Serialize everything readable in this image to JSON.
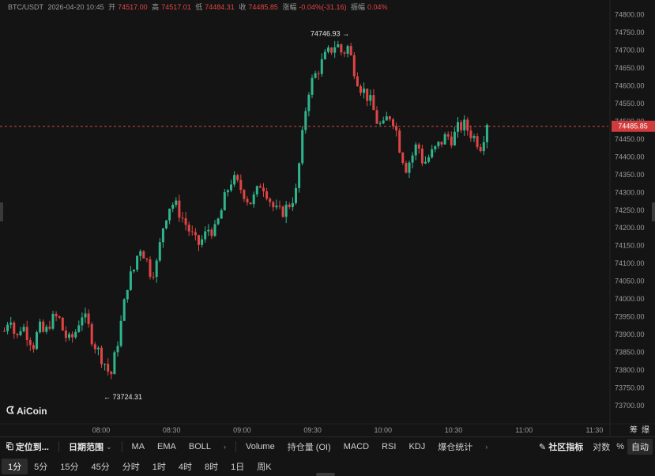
{
  "header": {
    "pair": "BTC/USDT",
    "datetime": "2026-04-20 10:45",
    "open_label": "开",
    "open_value": "74517.00",
    "high_label": "高",
    "high_value": "74517.01",
    "low_label": "低",
    "low_value": "74484.31",
    "close_label": "收",
    "close_value": "74485.85",
    "change_label": "涨幅",
    "change_value": "-0.04%(-31.16)",
    "amplitude_label": "振幅",
    "amplitude_value": "0.04%"
  },
  "logo": {
    "text": "AiCoin",
    "icon": "aicoin-logo-icon"
  },
  "colors": {
    "up": "#2fb58d",
    "down": "#e04545",
    "price_line": "#c94a4a",
    "background": "#141414",
    "axis_text": "#9a9a9a"
  },
  "chart_data": {
    "type": "candlestick",
    "ylim": [
      73680,
      74810
    ],
    "y_ticks": [
      "74800.00",
      "74750.00",
      "74700.00",
      "74650.00",
      "74600.00",
      "74550.00",
      "74500.00",
      "74450.00",
      "74400.00",
      "74350.00",
      "74300.00",
      "74250.00",
      "74200.00",
      "74150.00",
      "74100.00",
      "74050.00",
      "74000.00",
      "73950.00",
      "73900.00",
      "73850.00",
      "73800.00",
      "73750.00",
      "73700.00"
    ],
    "x_ticks": [
      "08:00",
      "08:30",
      "09:00",
      "09:30",
      "10:00",
      "10:30",
      "11:00",
      "11:30"
    ],
    "current_price": "74485.85",
    "high_annotation": "74746.93",
    "low_annotation": "73724.31",
    "close_path": [
      [
        73910,
        0
      ],
      [
        73960,
        3
      ],
      [
        73880,
        6
      ],
      [
        73930,
        9
      ],
      [
        73900,
        12
      ],
      [
        73870,
        15
      ],
      [
        73920,
        18
      ],
      [
        73900,
        21
      ],
      [
        73940,
        24
      ],
      [
        73950,
        28
      ],
      [
        73900,
        31
      ],
      [
        73880,
        34
      ],
      [
        73910,
        37
      ],
      [
        73960,
        40
      ],
      [
        73930,
        43
      ],
      [
        73880,
        46
      ],
      [
        73850,
        49
      ],
      [
        73820,
        52
      ],
      [
        73780,
        55
      ],
      [
        73860,
        58
      ],
      [
        73950,
        61
      ],
      [
        74050,
        64
      ],
      [
        74080,
        67
      ],
      [
        74150,
        70
      ],
      [
        74120,
        73
      ],
      [
        74070,
        76
      ],
      [
        74100,
        79
      ],
      [
        74200,
        82
      ],
      [
        74260,
        85
      ],
      [
        74270,
        88
      ],
      [
        74240,
        91
      ],
      [
        74210,
        94
      ],
      [
        74180,
        97
      ],
      [
        74150,
        100
      ],
      [
        74170,
        103
      ],
      [
        74200,
        106
      ],
      [
        74190,
        109
      ],
      [
        74240,
        112
      ],
      [
        74300,
        115
      ],
      [
        74340,
        118
      ],
      [
        74320,
        121
      ],
      [
        74300,
        124
      ],
      [
        74270,
        127
      ],
      [
        74290,
        130
      ],
      [
        74330,
        133
      ],
      [
        74300,
        136
      ],
      [
        74260,
        139
      ],
      [
        74240,
        142
      ],
      [
        74250,
        145
      ],
      [
        74270,
        148
      ],
      [
        74300,
        151
      ],
      [
        74440,
        154
      ],
      [
        74580,
        157
      ],
      [
        74620,
        160
      ],
      [
        74650,
        163
      ],
      [
        74680,
        166
      ],
      [
        74700,
        169
      ],
      [
        74720,
        172
      ],
      [
        74690,
        175
      ],
      [
        74710,
        178
      ],
      [
        74650,
        181
      ],
      [
        74600,
        184
      ],
      [
        74580,
        187
      ],
      [
        74550,
        190
      ],
      [
        74500,
        193
      ],
      [
        74480,
        196
      ],
      [
        74520,
        199
      ],
      [
        74500,
        202
      ],
      [
        74420,
        205
      ],
      [
        74370,
        208
      ],
      [
        74400,
        211
      ],
      [
        74440,
        214
      ],
      [
        74380,
        217
      ],
      [
        74400,
        220
      ],
      [
        74420,
        223
      ],
      [
        74440,
        226
      ],
      [
        74460,
        229
      ],
      [
        74450,
        232
      ],
      [
        74480,
        235
      ],
      [
        74490,
        238
      ],
      [
        74470,
        241
      ],
      [
        74450,
        244
      ],
      [
        74430,
        247
      ],
      [
        74500,
        250
      ]
    ]
  },
  "toolbar": {
    "locate": "定位到...",
    "date_range": "日期范围",
    "indicators_main": [
      "MA",
      "EMA",
      "BOLL"
    ],
    "indicators_sub": [
      "Volume",
      "持仓量 (OI)",
      "MACD",
      "RSI",
      "KDJ",
      "爆仓统计"
    ],
    "community": "社区指标",
    "log_scale": "对数",
    "percent": "%",
    "auto": "自动",
    "depth_tab": "筹",
    "liq_tab": "爆"
  },
  "timeframes": [
    "1分",
    "5分",
    "15分",
    "45分",
    "分时",
    "1时",
    "4时",
    "8时",
    "1日",
    "周K"
  ],
  "active_timeframe": "1分"
}
